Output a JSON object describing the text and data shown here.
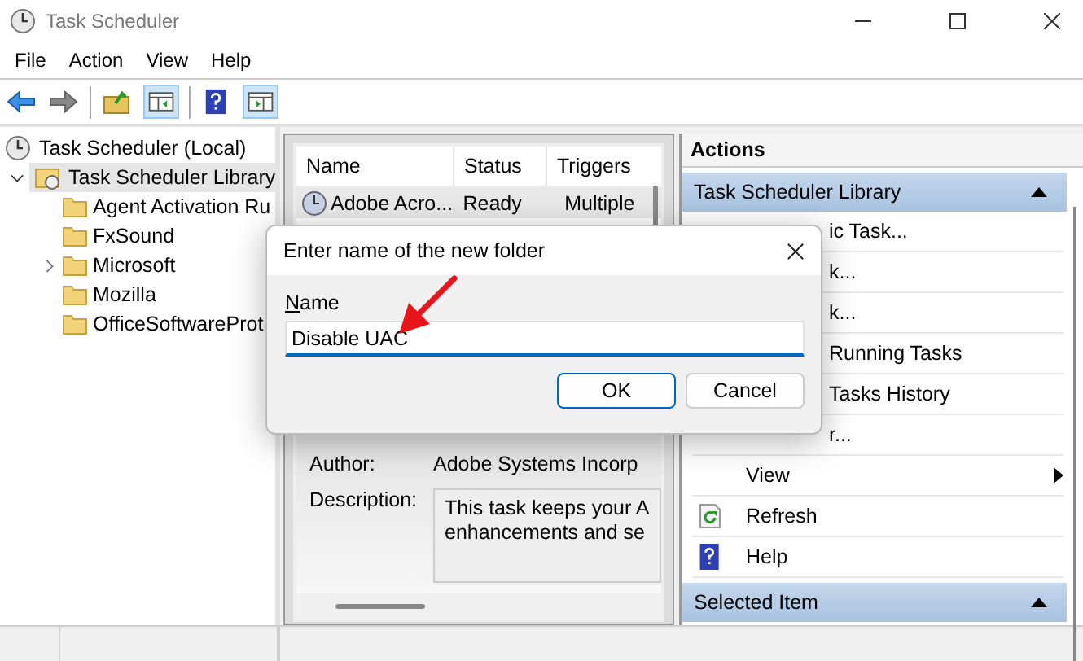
{
  "window": {
    "title": "Task Scheduler"
  },
  "menu": [
    "File",
    "Action",
    "View",
    "Help"
  ],
  "tree": {
    "label": "Task Scheduler (Local)",
    "children": [
      {
        "label": "Task Scheduler Library",
        "expanded": true,
        "selected": true,
        "children": [
          {
            "label": "Agent Activation Ru",
            "collapsed": false
          },
          {
            "label": "FxSound",
            "collapsed": false
          },
          {
            "label": "Microsoft",
            "collapsed": true
          },
          {
            "label": "Mozilla",
            "collapsed": false
          },
          {
            "label": "OfficeSoftwareProt",
            "collapsed": false
          }
        ]
      }
    ]
  },
  "tasks": {
    "columns": [
      "Name",
      "Status",
      "Triggers"
    ],
    "rows": [
      {
        "cells": [
          "Adobe Acro...",
          "Ready",
          "Multiple"
        ],
        "selected": true
      }
    ]
  },
  "details": [
    {
      "label": "Author:",
      "value": "Adobe Systems Incorp"
    },
    {
      "label": "Description:",
      "lines": [
        "This task keeps your A",
        "enhancements and se"
      ]
    }
  ],
  "actions": {
    "title": "Actions",
    "sections": [
      {
        "title": "Task Scheduler Library",
        "expanded": true,
        "items": [
          {
            "label": "ic Task...",
            "kind": "partial"
          },
          {
            "label": "k...",
            "kind": "partial"
          },
          {
            "label": "k...",
            "kind": "partial"
          },
          {
            "label": "Running Tasks",
            "kind": "partial"
          },
          {
            "label": "Tasks History",
            "kind": "partial"
          },
          {
            "label": "r...",
            "kind": "partial"
          },
          {
            "label": "View",
            "kind": "submenu"
          },
          {
            "label": "Refresh",
            "kind": "refresh"
          },
          {
            "label": "Help",
            "kind": "help"
          }
        ]
      },
      {
        "title": "Selected Item",
        "expanded": true
      }
    ]
  },
  "dialog": {
    "title": "Enter name of the new folder",
    "field_label": "Name",
    "value": "Disable UAC",
    "buttons": [
      {
        "label": "OK",
        "default": true
      },
      {
        "label": "Cancel",
        "default": false
      }
    ]
  }
}
